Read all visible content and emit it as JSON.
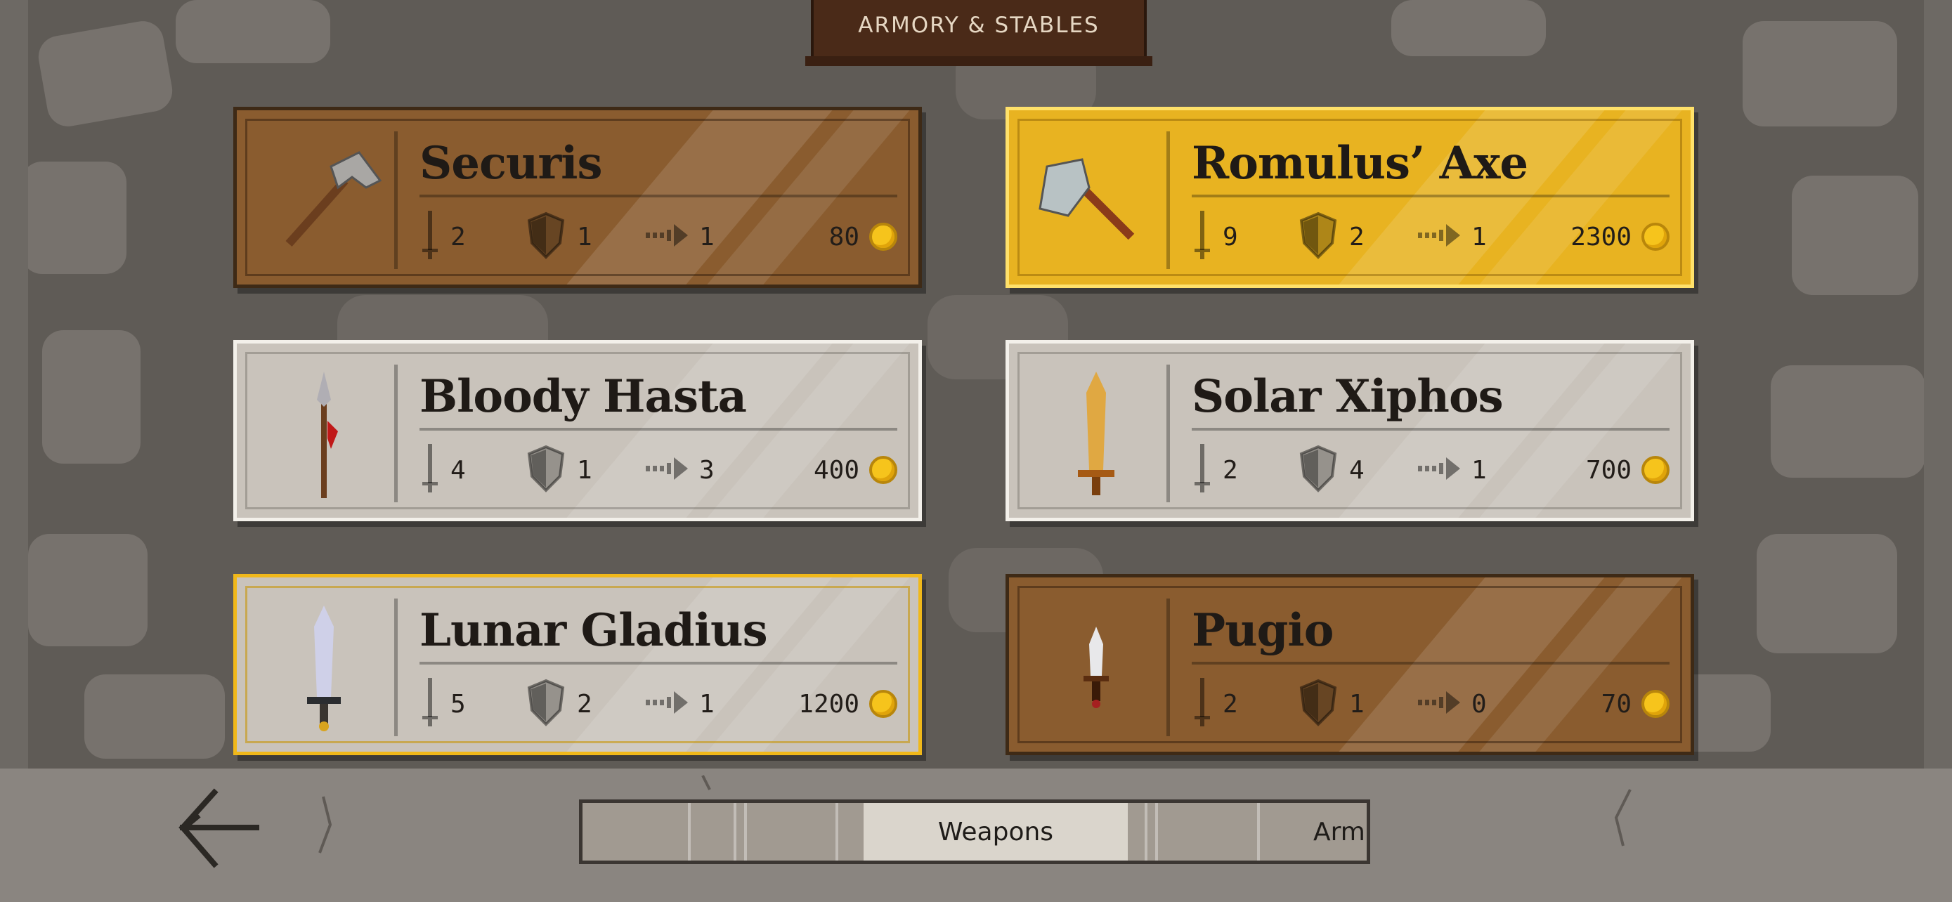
{
  "header": {
    "title": "ARMORY & STABLES"
  },
  "stat_icons": {
    "attack": "sword-icon",
    "defense": "shield-icon",
    "speed": "arrow-icon",
    "currency": "gold-coin-icon"
  },
  "items": [
    {
      "name": "Securis",
      "attack": "2",
      "defense": "1",
      "speed": "1",
      "price": "80",
      "icon": "axe-icon",
      "style": "wood"
    },
    {
      "name": "Romulus’ Axe",
      "attack": "9",
      "defense": "2",
      "speed": "1",
      "price": "2300",
      "icon": "battle-axe-icon",
      "style": "gold"
    },
    {
      "name": "Bloody Hasta",
      "attack": "4",
      "defense": "1",
      "speed": "3",
      "price": "400",
      "icon": "spear-icon",
      "style": "silver"
    },
    {
      "name": "Solar Xiphos",
      "attack": "2",
      "defense": "4",
      "speed": "1",
      "price": "700",
      "icon": "golden-sword-icon",
      "style": "silver"
    },
    {
      "name": "Lunar Gladius",
      "attack": "5",
      "defense": "2",
      "speed": "1",
      "price": "1200",
      "icon": "silver-sword-icon",
      "style": "silver-gold"
    },
    {
      "name": "Pugio",
      "attack": "2",
      "defense": "1",
      "speed": "0",
      "price": "70",
      "icon": "dagger-icon",
      "style": "wood"
    }
  ],
  "tabs": {
    "active": "Weapons",
    "next": "Arm"
  },
  "colors": {
    "wood": "#8a5c2f",
    "gold": "#e8b321",
    "silver": "#c9c3bb",
    "coin": "#f6c41c"
  }
}
